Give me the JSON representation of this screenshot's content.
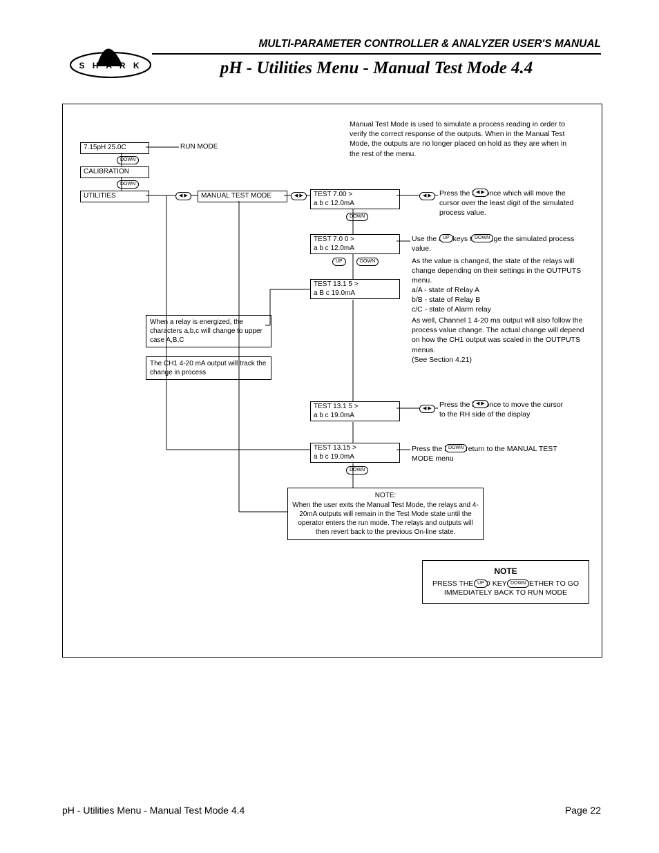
{
  "header": {
    "manual_title": "MULTI-PARAMETER CONTROLLER & ANALYZER USER'S MANUAL",
    "page_title": "pH - Utilities Menu - Manual Test Mode 4.4",
    "logo_letters": "S H A R K"
  },
  "intro": "Manual Test Mode is used to simulate a process reading in order to verify the correct response of the outputs. When in the Manual Test Mode, the outputs are no longer placed on hold as they are when in the rest of the menu.",
  "lcd": {
    "run_top": "7.15pH   25.0C",
    "calibration": "CALIBRATION",
    "utilities": "UTILITIES",
    "manual_test_mode": "MANUAL TEST MODE",
    "t1_l1": "TEST                 7.00 >",
    "t1_l2": "a  b  c     12.0mA",
    "t2_l1": "TEST               7.0 0 >",
    "t2_l2": "a  b  c     12.0mA",
    "t3_l1": "TEST             13.1 5 >",
    "t3_l2": "a  B  c     19.0mA",
    "t4_l1": "TEST             13.1 5 >",
    "t4_l2": "a  b  c  19.0mA",
    "t5_l1": "TEST              13.15  >",
    "t5_l2": "a  b  c  19.0mA"
  },
  "labels": {
    "run_mode": "RUN MODE",
    "down": "DOWN",
    "up": "UP",
    "lr": "◀ ▶"
  },
  "callouts": {
    "relay_case": "When a relay is energized, the characters a,b,c will change to upper case A,B,C",
    "ch1_track": "The CH1 4-20 mA output will track the change in process"
  },
  "instr": {
    "press_lr_once": "Press the            key once which will move the cursor over the least digit of the simulated process value.",
    "use_up_down": "Use the            and             keys to change the simulated process value.",
    "as_value_changes": "As the value is changed, the state of the relays will change depending on their settings in the OUTPUTS menu.",
    "relay_states": "a/A - state of Relay A\nb/B - state of Relay B\nc/C - state of Alarm relay",
    "as_well": "As well, Channel 1 4-20 ma output will also follow the process value change. The actual change will depend on how the CH1 output was scaled in the OUTPUTS menus.\n(See Section 4.21)",
    "press_lr_rh": "Press the            key once to move the cursor  to the RH side of the display",
    "press_down_return": "Press the             key to return to the MANUAL TEST MODE menu"
  },
  "midnote": {
    "title": "NOTE:",
    "body": "When the user exits the Manual Test Mode, the relays and 4-20mA outputs will remain in the Test Mode state until the operator enters the run mode. The relays and outputs will then revert back to the previous On-line state."
  },
  "bignote": {
    "title": "NOTE",
    "body": "PRESS THE           AND             KEYS TOGETHER TO GO IMMEDIATELY BACK TO RUN MODE"
  },
  "footer": {
    "left": "pH - Utilities Menu - Manual Test Mode 4.4",
    "right": "Page 22"
  }
}
